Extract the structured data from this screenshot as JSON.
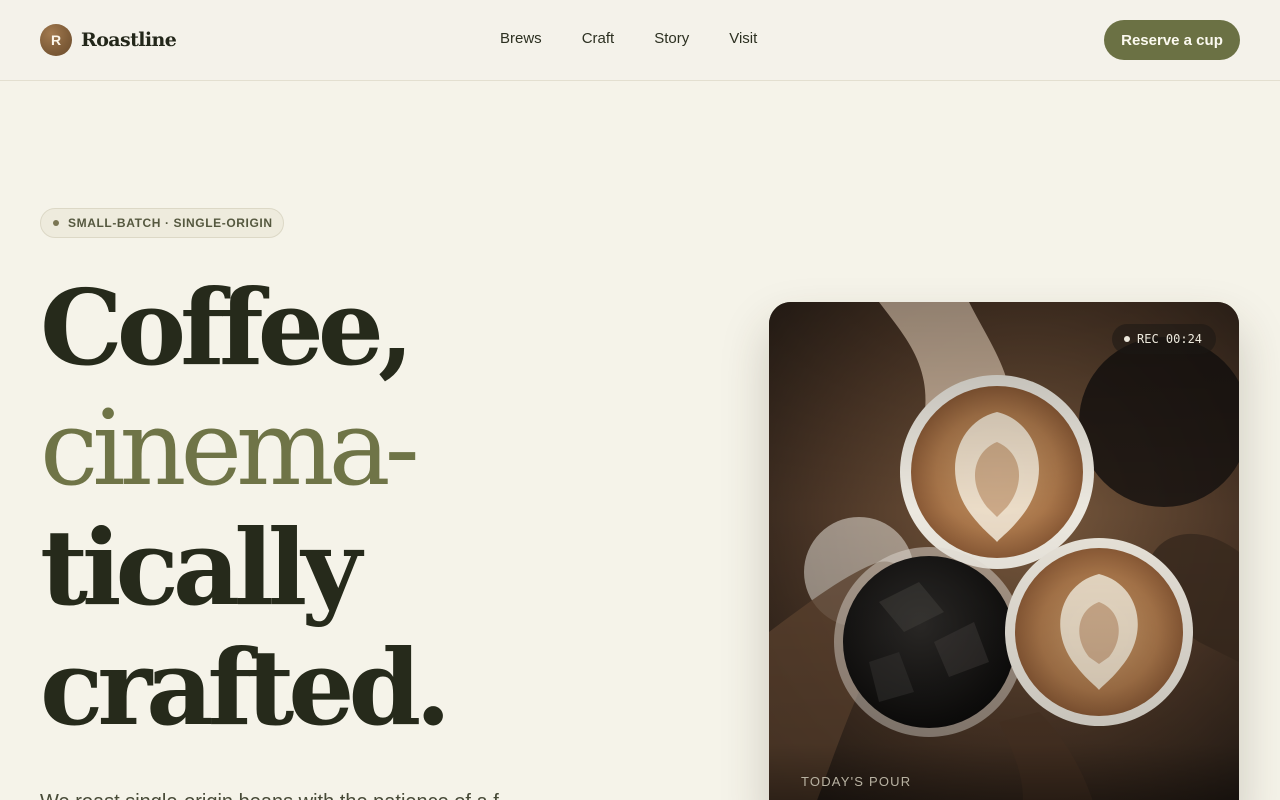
{
  "brand": {
    "initial": "R",
    "name": "Roastline"
  },
  "nav": {
    "items": [
      {
        "label": "Brews"
      },
      {
        "label": "Craft"
      },
      {
        "label": "Story"
      },
      {
        "label": "Visit"
      }
    ],
    "cta_label": "Reserve a cup"
  },
  "hero": {
    "eyebrow": "SMALL-BATCH · SINGLE-ORIGIN",
    "headline": {
      "line1": "Coffee,",
      "line2": "cinema-",
      "line3": "tically",
      "line4": "crafted."
    },
    "lede": "We roast single-origin beans with the patience of a f"
  },
  "video": {
    "rec_label": "REC 00:24",
    "caption": "TODAY'S POUR"
  },
  "icons": {
    "recording": "recording-dot-icon"
  },
  "colors": {
    "background": "#f5f3e9",
    "accent_olive": "#6b7144",
    "headline_dark": "#262a1b",
    "headline_accent": "#6f7447",
    "brand_mark": "#7e5c38"
  }
}
